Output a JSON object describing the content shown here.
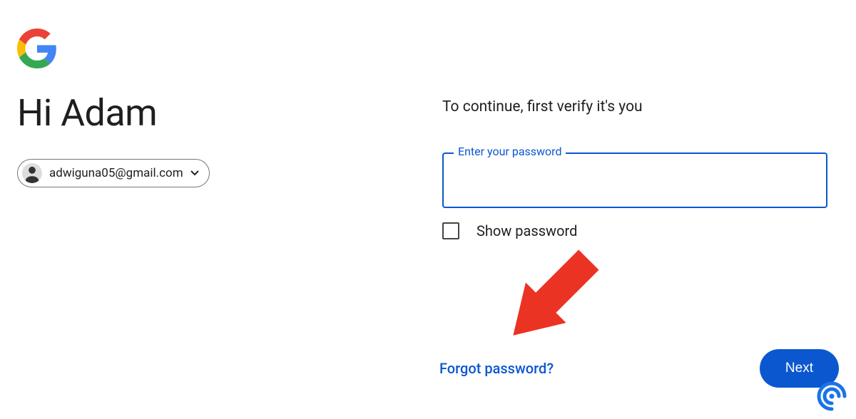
{
  "greeting": "Hi Adam",
  "account": {
    "email": "adwiguna05@gmail.com"
  },
  "instruction": "To continue, first verify it's you",
  "password_field": {
    "label": "Enter your password",
    "value": ""
  },
  "show_password": {
    "label": "Show password",
    "checked": false
  },
  "actions": {
    "forgot": "Forgot password?",
    "next": "Next"
  },
  "colors": {
    "primary": "#0b57d0",
    "arrow": "#eb3323"
  }
}
